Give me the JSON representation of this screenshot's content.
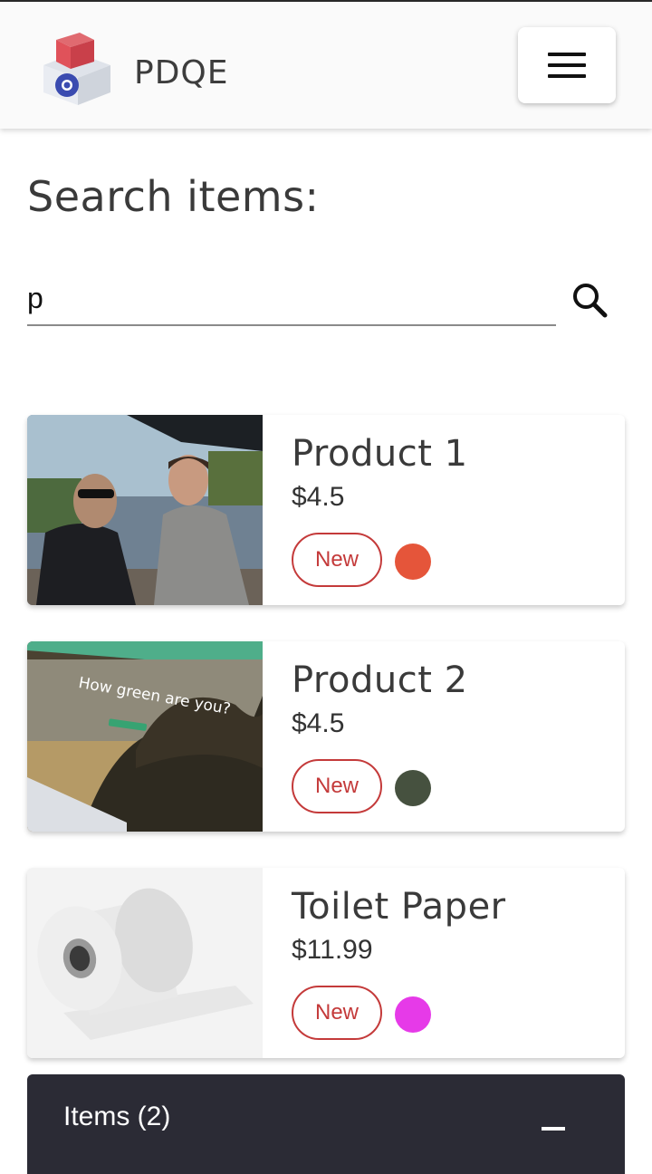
{
  "header": {
    "brand": "PDQE",
    "menu_icon": "hamburger-menu-icon"
  },
  "search": {
    "title": "Search items:",
    "value": "p",
    "placeholder": "",
    "icon": "search-icon"
  },
  "products": [
    {
      "name": "Product 1",
      "price": "$4.5",
      "badge": "New",
      "color": "#e5553a",
      "image": "photo-two-men-at-beach"
    },
    {
      "name": "Product 2",
      "price": "$4.5",
      "badge": "New",
      "color": "#46513f",
      "image": "photo-how-green-are-you-website"
    },
    {
      "name": "Toilet Paper",
      "price": "$11.99",
      "badge": "New",
      "color": "#e63ae8",
      "image": "photo-toilet-paper-roll"
    }
  ],
  "items_panel": {
    "label": "Items (2)",
    "toggle_icon": "collapse-icon"
  }
}
